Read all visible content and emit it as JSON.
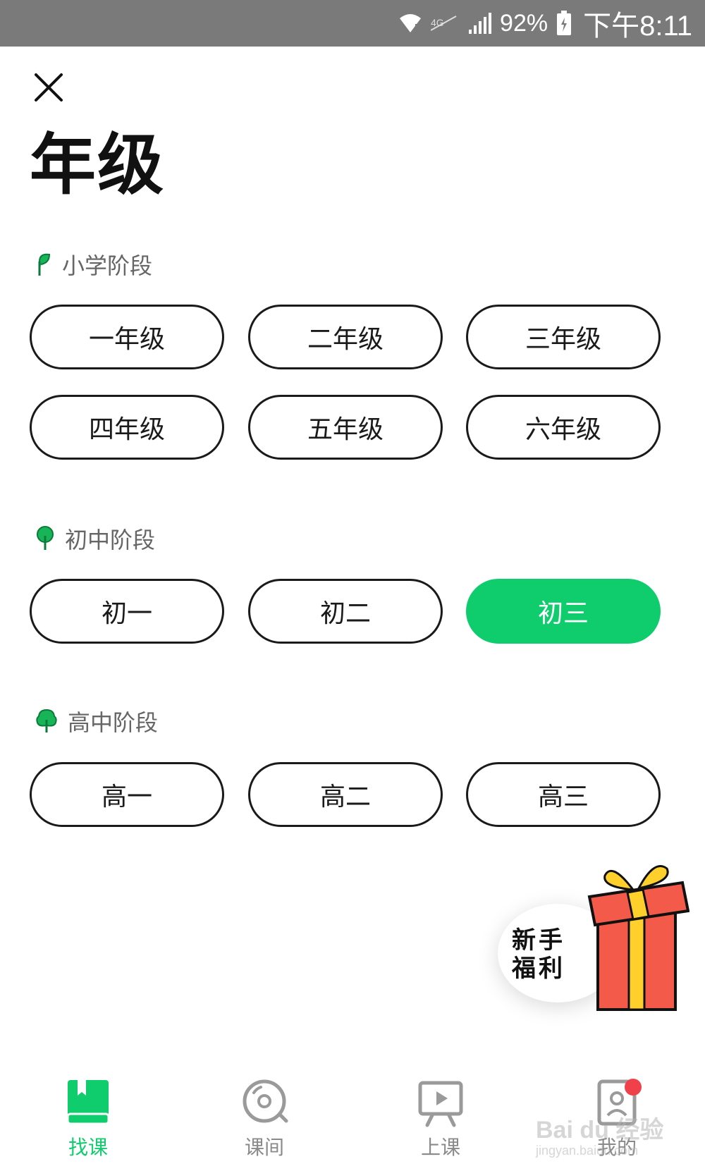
{
  "status_bar": {
    "battery": "92%",
    "time": "下午8:11"
  },
  "header": {
    "title": "年级"
  },
  "sections": [
    {
      "label": "小学阶段",
      "grades": [
        "一年级",
        "二年级",
        "三年级",
        "四年级",
        "五年级",
        "六年级"
      ]
    },
    {
      "label": "初中阶段",
      "grades": [
        "初一",
        "初二",
        "初三"
      ],
      "selected": "初三"
    },
    {
      "label": "高中阶段",
      "grades": [
        "高一",
        "高二",
        "高三"
      ]
    }
  ],
  "gift": {
    "line1": "新手",
    "line2": "福利"
  },
  "bottom_nav": [
    {
      "label": "找课",
      "icon": "book-icon",
      "active": true
    },
    {
      "label": "课间",
      "icon": "disc-icon",
      "active": false
    },
    {
      "label": "上课",
      "icon": "play-board-icon",
      "active": false
    },
    {
      "label": "我的",
      "icon": "profile-icon",
      "active": false,
      "badge": true
    }
  ],
  "colors": {
    "accent": "#0fcc6c",
    "badge": "#f0404a",
    "status_bar": "#7a7a7a"
  }
}
